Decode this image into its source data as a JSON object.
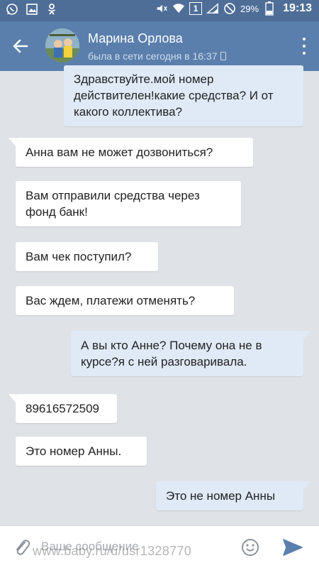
{
  "status_bar": {
    "battery_percent": "29%",
    "network_badge": "1",
    "time": "19:13"
  },
  "header": {
    "contact_name": "Марина Орлова",
    "contact_status": "была в сети сегодня в 16:37"
  },
  "messages": [
    {
      "direction": "out",
      "text": "Здравствуйте.мой номер действителен!какие средства? И от какого коллектива?"
    },
    {
      "direction": "in",
      "text": "Анна вам не может дозвониться?"
    },
    {
      "direction": "in",
      "text": "Вам отправили средства через фонд банк!"
    },
    {
      "direction": "in",
      "text": "Вам чек поступил?"
    },
    {
      "direction": "in",
      "text": "Вас ждем, платежи отменять?"
    },
    {
      "direction": "out",
      "text": "А вы кто Анне? Почему она не в курсе?я с ней разговаривала."
    },
    {
      "direction": "in",
      "text": "89616572509"
    },
    {
      "direction": "in",
      "text": "Это номер Анны."
    },
    {
      "direction": "out",
      "text": "Это не номер Анны"
    }
  ],
  "composer": {
    "placeholder": "Ваше сообщение",
    "watermark": "www.baby.ru/u/usr1328770"
  },
  "colors": {
    "status_bar": "#4e6e98",
    "header": "#5a7fad",
    "chat_background": "#dfe3e8",
    "incoming_bubble": "#ffffff",
    "outgoing_bubble": "#dfeaf6",
    "send_icon": "#5a7fad"
  },
  "icons": {
    "status_left": [
      "whatsapp-icon",
      "gallery-icon",
      "odnoklassniki-icon"
    ],
    "status_right": [
      "mute-icon",
      "wifi-icon",
      "signal-icon",
      "no-sim-icon",
      "battery-icon"
    ],
    "header": [
      "back-arrow-icon",
      "phone-icon",
      "more-vert-icon"
    ],
    "composer": [
      "paperclip-icon",
      "emoji-icon",
      "send-icon"
    ]
  }
}
